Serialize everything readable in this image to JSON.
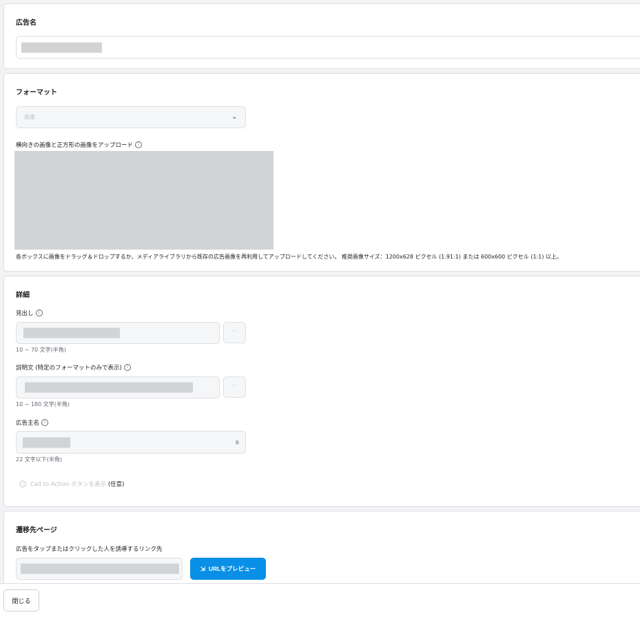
{
  "ad_name": {
    "title": "広告名"
  },
  "format": {
    "title": "フォーマット",
    "select_value": "画像",
    "upload_label": "横向きの画像と正方形の画像をアップロード",
    "upload_help": "各ボックスに画像をドラッグ＆ドロップするか、メディアライブラリから既存の広告画像を再利用してアップロードしてください。 推奨画像サイズ：1200x628 ピクセル (1.91:1) または 600x600 ピクセル (1:1) 以上。"
  },
  "details": {
    "title": "詳細",
    "headline_label": "見出し",
    "headline_hint": "10 ~ 70 文字(半角)",
    "description_label": "説明文 (特定のフォーマットのみで表示)",
    "description_hint": "10 ~ 180 文字(半角)",
    "advertiser_label": "広告主名",
    "advertiser_count": "6",
    "advertiser_hint": "22 文字以下(半角)",
    "cta_label": "Call to Action ボタンを表示",
    "cta_optional": "(任意)",
    "more_button": "···"
  },
  "destination": {
    "title": "遷移先ページ",
    "link_label": "広告をタップまたはクリックした人を誘導するリンク先",
    "preview_button": "URLをプレビュー"
  },
  "footer": {
    "close_button": "閉じる"
  },
  "icons": {
    "info": "ⓘ",
    "chevron": "⌄",
    "preview": "⇲"
  },
  "colors": {
    "primary": "#0a8fe6",
    "redacted": "#d2d3d5"
  }
}
